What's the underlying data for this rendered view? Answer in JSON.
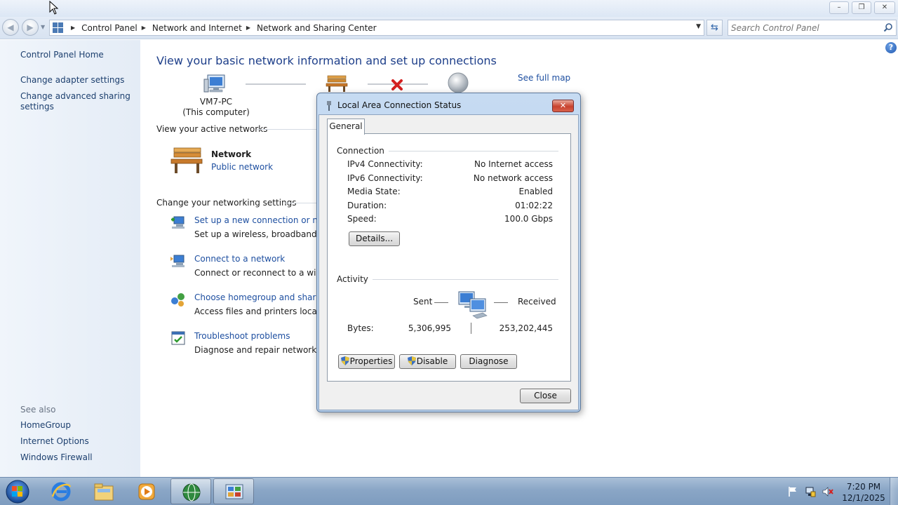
{
  "window": {
    "buttons": {
      "minimize": "–",
      "maximize": "❐",
      "close": "✕"
    }
  },
  "address": {
    "breadcrumbs": [
      "Control Panel",
      "Network and Internet",
      "Network and Sharing Center"
    ],
    "search_placeholder": "Search Control Panel"
  },
  "sidebar": {
    "home": "Control Panel Home",
    "links": [
      "Change adapter settings",
      "Change advanced sharing settings"
    ],
    "see_also_heading": "See also",
    "see_also": [
      "HomeGroup",
      "Internet Options",
      "Windows Firewall"
    ]
  },
  "main": {
    "heading": "View your basic network information and set up connections",
    "see_full_map": "See full map",
    "computer_name": "VM7-PC",
    "computer_caption": "(This computer)",
    "active_heading": "View your active networks",
    "network_name": "Network",
    "network_type": "Public network",
    "settings_heading": "Change your networking settings",
    "tasks": [
      {
        "title": "Set up a new connection or netw",
        "desc": "Set up a wireless, broadband, dial",
        "icon": "new-connection-icon"
      },
      {
        "title": "Connect to a network",
        "desc": "Connect or reconnect to a wireles",
        "icon": "connect-network-icon"
      },
      {
        "title": "Choose homegroup and sharing",
        "desc": "Access files and printers located o",
        "icon": "homegroup-icon"
      },
      {
        "title": "Troubleshoot problems",
        "desc": "Diagnose and repair network prol",
        "icon": "troubleshoot-icon"
      }
    ]
  },
  "dialog": {
    "title": "Local Area Connection Status",
    "tab": "General",
    "connection_label": "Connection",
    "fields": [
      {
        "key": "IPv4 Connectivity:",
        "value": "No Internet access"
      },
      {
        "key": "IPv6 Connectivity:",
        "value": "No network access"
      },
      {
        "key": "Media State:",
        "value": "Enabled"
      },
      {
        "key": "Duration:",
        "value": "01:02:22"
      },
      {
        "key": "Speed:",
        "value": "100.0 Gbps"
      }
    ],
    "details_button": "Details...",
    "activity_label": "Activity",
    "sent_label": "Sent",
    "received_label": "Received",
    "bytes_label": "Bytes:",
    "bytes_sent": "5,306,995",
    "bytes_received": "253,202,445",
    "properties_button": "Properties",
    "disable_button": "Disable",
    "diagnose_button": "Diagnose",
    "close_button": "Close"
  },
  "taskbar": {
    "apps": [
      "internet-explorer-icon",
      "windows-explorer-icon",
      "media-player-icon",
      "network-center-icon",
      "control-panel-icon"
    ],
    "time": "7:20 PM",
    "date": "12/1/2025"
  },
  "colors": {
    "link": "#1e4fa0",
    "heading": "#1e3f8a",
    "taskbar": "#8aa6c6",
    "dialog_frame": "#c6dbf2"
  }
}
